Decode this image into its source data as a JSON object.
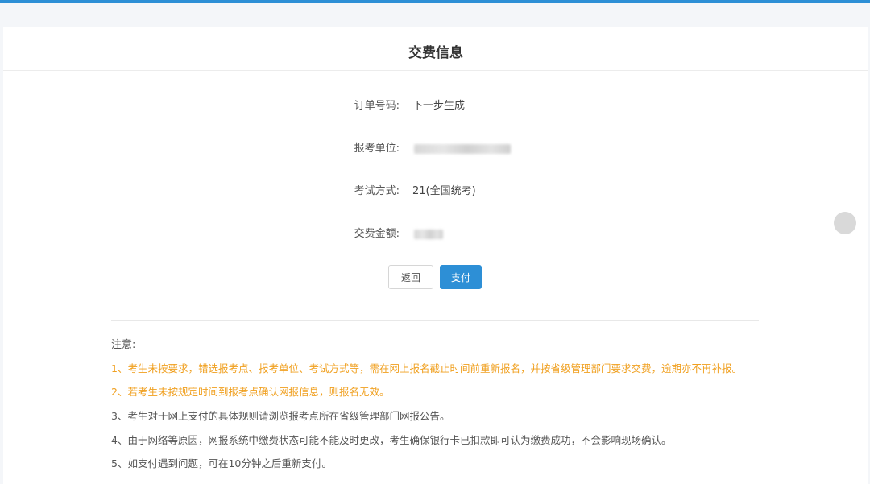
{
  "header": {
    "title": "交费信息"
  },
  "form": {
    "order_no": {
      "label": "订单号码:",
      "value": "下一步生成"
    },
    "unit": {
      "label": "报考单位:"
    },
    "exam_mode": {
      "label": "考试方式:",
      "value": "21(全国统考)"
    },
    "amount": {
      "label": "交费金额:"
    }
  },
  "actions": {
    "back_label": "返回",
    "pay_label": "支付"
  },
  "notes": {
    "title": "注意:",
    "items": [
      "1、考生未按要求，错选报考点、报考单位、考试方式等，需在网上报名截止时间前重新报名，并按省级管理部门要求交费，逾期亦不再补报。",
      "2、若考生未按规定时间到报考点确认网报信息，则报名无效。",
      "3、考生对于网上支付的具体规则请浏览报考点所在省级管理部门网报公告。",
      "4、由于网络等原因，网报系统中缴费状态可能不能及时更改，考生确保银行卡已扣款即可认为缴费成功，不会影响现场确认。",
      "5、如支付遇到问题，可在10分钟之后重新支付。"
    ]
  },
  "colors": {
    "accent": "#2d8fd6",
    "warning": "#f0a020"
  }
}
